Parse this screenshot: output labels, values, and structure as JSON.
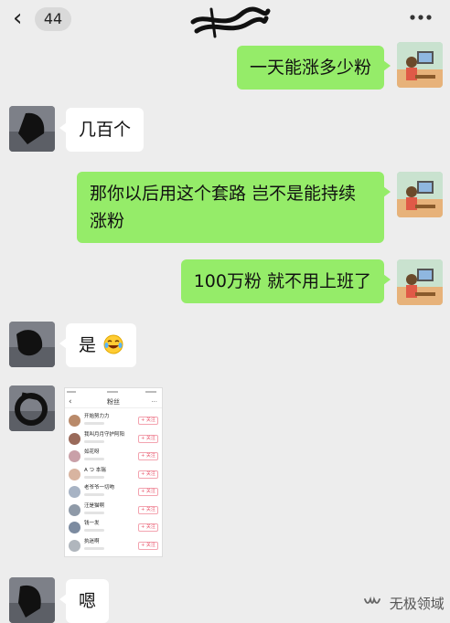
{
  "header": {
    "unread_count": "44",
    "back_icon": "chevron-left-icon",
    "more_icon": "more-dots-icon"
  },
  "messages": [
    {
      "id": "m1",
      "side": "out",
      "text": "一天能涨多少粉"
    },
    {
      "id": "m2",
      "side": "in",
      "text": "几百个"
    },
    {
      "id": "m3",
      "side": "out",
      "text": "那你以后用这个套路  岂不是能持续涨粉"
    },
    {
      "id": "m4",
      "side": "out",
      "text": "100万粉  就不用上班了"
    },
    {
      "id": "m5",
      "side": "in",
      "text": "是",
      "emoji": "laughing-tears-emoji"
    },
    {
      "id": "m6",
      "side": "in",
      "type": "image"
    },
    {
      "id": "m7",
      "side": "in",
      "text": "嗯"
    }
  ],
  "shared_screenshot": {
    "title": "粉丝",
    "more": "···",
    "button_label": "+ 关注",
    "followers": [
      {
        "name": "开始努力力"
      },
      {
        "name": "我叫月月守护阿阳"
      },
      {
        "name": "如花呀"
      },
      {
        "name": "A つ 本瑞"
      },
      {
        "name": "老爷爷一切吻"
      },
      {
        "name": "汪是猫啊"
      },
      {
        "name": "钱一发"
      },
      {
        "name": "执迷啊"
      }
    ]
  },
  "watermark": {
    "text": "无极领域",
    "icon": "wechat-channel-icon"
  },
  "colors": {
    "background": "#ededed",
    "outgoing_bubble": "#95ec69",
    "incoming_bubble": "#ffffff"
  }
}
